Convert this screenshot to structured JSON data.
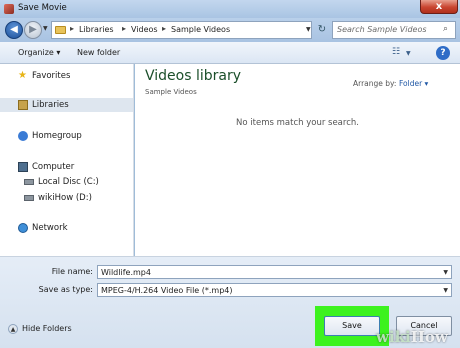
{
  "window": {
    "title": "Save Movie",
    "close_label": "x"
  },
  "address": {
    "crumbs": [
      "Libraries",
      "Videos",
      "Sample Videos"
    ],
    "separator": "▸",
    "search_placeholder": "Search Sample Videos"
  },
  "toolbar": {
    "organize_label": "Organize ▾",
    "new_folder_label": "New folder",
    "help_label": "?"
  },
  "nav": {
    "favorites": "Favorites",
    "libraries": "Libraries",
    "homegroup": "Homegroup",
    "computer": "Computer",
    "local_disc": "Local Disc (C:)",
    "wikihow_drive": "wikiHow (D:)",
    "network": "Network"
  },
  "content": {
    "library_title": "Videos library",
    "library_subtitle": "Sample Videos",
    "arrange_label": "Arrange by:",
    "arrange_value": "Folder ▾",
    "empty_message": "No items match your search."
  },
  "form": {
    "file_name_label": "File name:",
    "file_name_value": "Wildlife.mp4",
    "save_type_label": "Save as type:",
    "save_type_value": "MPEG-4/H.264 Video File (*.mp4)"
  },
  "footer": {
    "hide_folders_label": "Hide Folders",
    "save_label": "Save",
    "cancel_label": "Cancel"
  },
  "watermark": {
    "part1": "wiki",
    "part2": "How"
  },
  "colors": {
    "highlight": "#3df21f",
    "library_title": "#1b4f2a",
    "link": "#1f57a5"
  }
}
